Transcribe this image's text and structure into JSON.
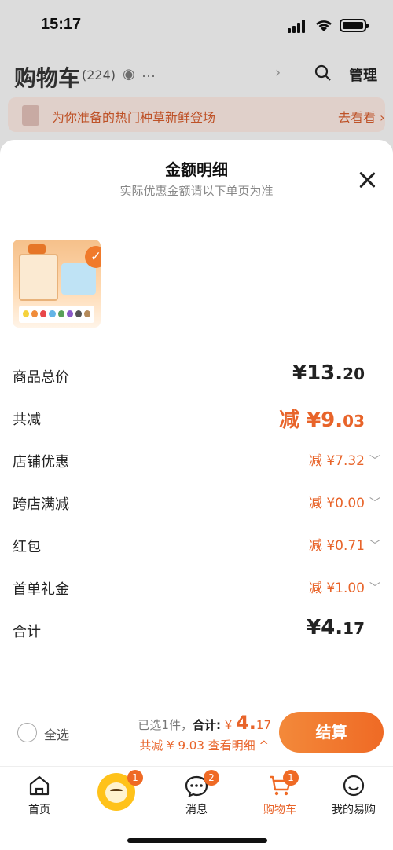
{
  "status_bar": {
    "time": "15:17"
  },
  "background": {
    "title": "购物车",
    "count": "(224)",
    "manage": "管理",
    "banner_text": "为你准备的热门种草新鲜登场",
    "banner_link": "去看看 ›"
  },
  "sheet": {
    "title": "金额明细",
    "subtitle": "实际优惠金额请以下单页为准",
    "rows": [
      {
        "label": "商品总价",
        "value": "¥13.",
        "value_small": "20"
      },
      {
        "label": "共减",
        "value": "减 ¥9.",
        "value_small": "03"
      },
      {
        "label": "店铺优惠",
        "value": "减 ¥7.32"
      },
      {
        "label": "跨店满减",
        "value": "减 ¥0.00"
      },
      {
        "label": "红包",
        "value": "减 ¥0.71"
      },
      {
        "label": "首单礼金",
        "value": "减 ¥1.00"
      },
      {
        "label": "合计",
        "value": "¥4.",
        "value_small": "17"
      }
    ]
  },
  "checkout": {
    "select_all": "全选",
    "selected_prefix": "已选1件，",
    "total_label": "合计:",
    "total_symbol": "¥",
    "total_int": "4.",
    "total_dec": "17",
    "discount_text": "共减 ¥ 9.03",
    "view_detail": "查看明细 ^",
    "button": "结算"
  },
  "tabbar": {
    "home": "首页",
    "mascot_badge": "1",
    "messages": "消息",
    "messages_badge": "2",
    "cart": "购物车",
    "cart_badge": "1",
    "mine": "我的易购"
  },
  "colors": {
    "accent": "#ef6a25",
    "discount": "#e8642a"
  }
}
